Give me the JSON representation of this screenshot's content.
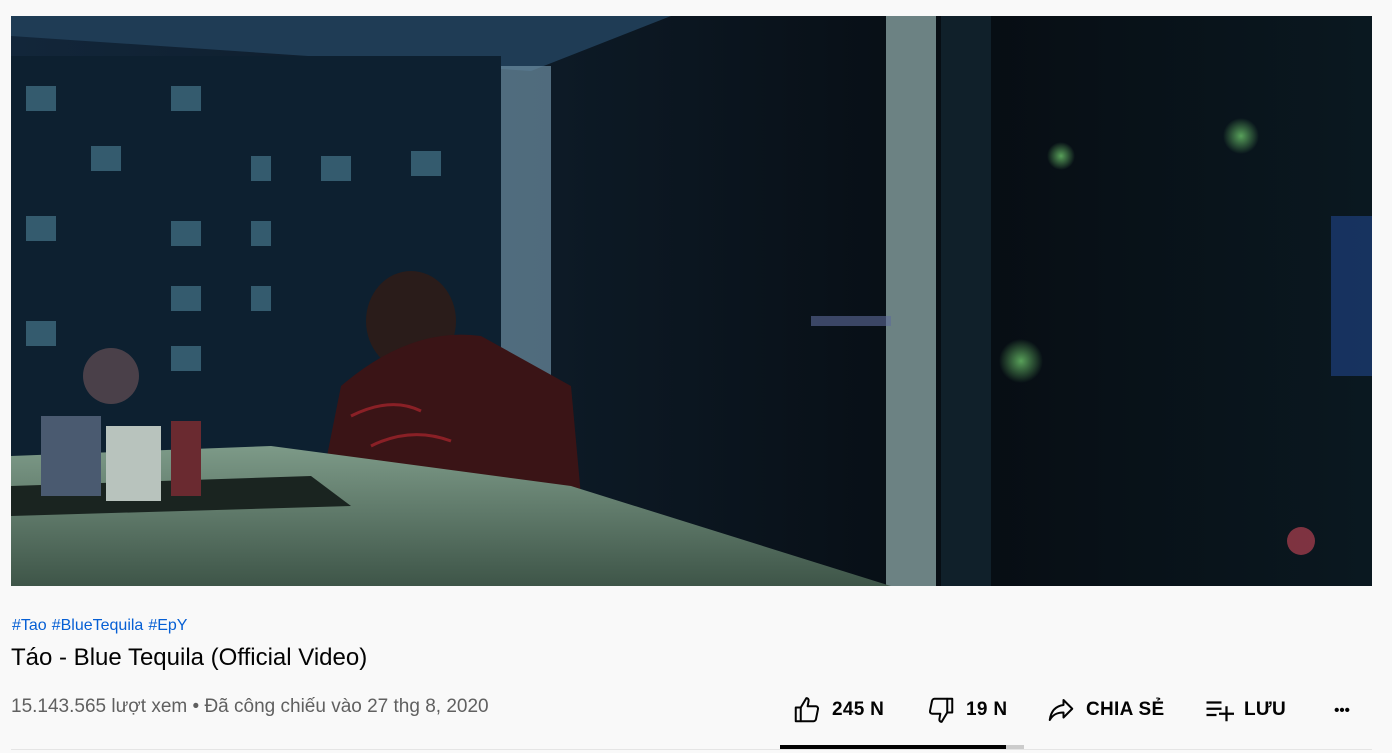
{
  "video": {
    "hashtags": [
      "#Tao",
      "#BlueTequila",
      "#EpY"
    ],
    "title": "Táo - Blue Tequila (Official Video)",
    "views": "15.143.565 lượt xem",
    "separator": "•",
    "premiered": "Đã công chiếu vào 27 thg 8, 2020"
  },
  "actions": {
    "like_count": "245 N",
    "dislike_count": "19 N",
    "share_label": "CHIA SẺ",
    "save_label": "LƯU",
    "more_label": "•••",
    "like_ratio": 0.928
  },
  "colors": {
    "link": "#065fd4",
    "text_primary": "#030303",
    "text_secondary": "#606060",
    "page_background": "#f9f9f9"
  }
}
